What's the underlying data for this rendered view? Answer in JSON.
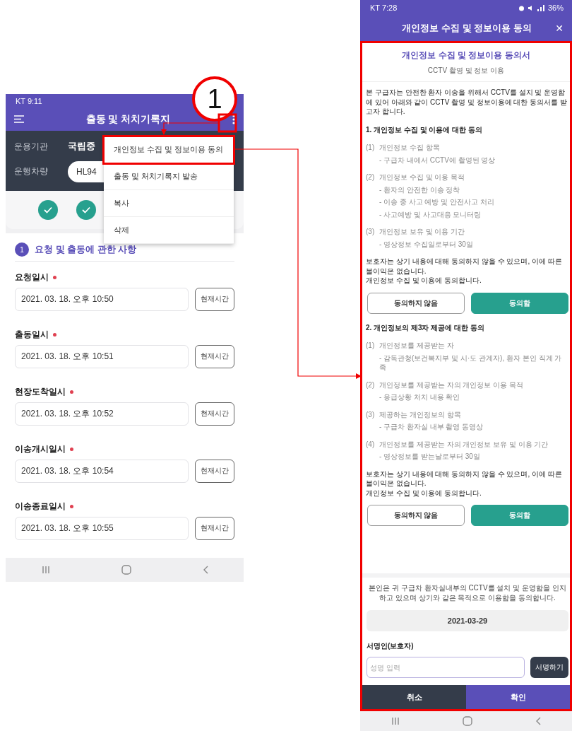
{
  "left_phone": {
    "status_bar": {
      "carrier_time": "KT 9:11"
    },
    "header": {
      "title": "출동 및 처치기록지"
    },
    "info": [
      {
        "kind": "text",
        "label": "운용기관",
        "value": "국립중"
      },
      {
        "kind": "pill",
        "label": "운행차량",
        "value": "HL94"
      }
    ],
    "steps": [
      {
        "done": true
      },
      {
        "done": true
      }
    ],
    "menu": [
      {
        "label": "개인정보 수집 및 정보이용 동의",
        "highlighted": true
      },
      {
        "label": "출동 및 처치기록지 발송",
        "highlighted": false
      },
      {
        "label": "복사",
        "highlighted": false
      },
      {
        "label": "삭제",
        "highlighted": false
      }
    ],
    "section": {
      "number": "1",
      "title": "요청 및 출동에 관한 사항"
    },
    "fields": [
      {
        "label": "요청일시",
        "required": true,
        "value": "2021. 03. 18. 오후 10:50",
        "button": "현재시간"
      },
      {
        "label": "출동일시",
        "required": true,
        "value": "2021. 03. 18. 오후 10:51",
        "button": "현재시간"
      },
      {
        "label": "현장도착일시",
        "required": true,
        "value": "2021. 03. 18. 오후 10:52",
        "button": "현재시간"
      },
      {
        "label": "이송개시일시",
        "required": true,
        "value": "2021. 03. 18. 오후 10:54",
        "button": "현재시간"
      },
      {
        "label": "이송종료일시",
        "required": true,
        "value": "2021. 03. 18. 오후 10:55",
        "button": "현재시간"
      }
    ]
  },
  "annotation": {
    "callout": "1"
  },
  "right_phone": {
    "status_bar": {
      "carrier_time": "KT 7:28",
      "battery": "36%"
    },
    "header": {
      "title": "개인정보 수집 및 정보이용 동의",
      "close": "✕"
    },
    "doc_title": "개인정보 수집 및 정보이용 동의서",
    "doc_subtitle": "CCTV 촬영 및 정보 이용",
    "intro": "본 구급차는 안전한 환자 이송을 위해서 CCTV를 설치 및 운영함에 있어 아래와 같이 CCTV 촬영 및 정보이용에 대한 동의서를 받고자 합니다.",
    "sections": [
      {
        "heading": "1. 개인정보 수집 및 이용에 대한 동의",
        "items": [
          {
            "num": "(1)",
            "title": "개인정보 수집 항목",
            "details": [
              "- 구급차 내에서 CCTV에 촬영된 영상"
            ]
          },
          {
            "num": "(2)",
            "title": "개인정보 수집 및 이용 목적",
            "details": [
              "- 환자의 안전한 이송 정착",
              "- 이송 중 사고 예방 및 안전사고 처리",
              "- 사고예방 및 사고대응 모니터링"
            ]
          },
          {
            "num": "(3)",
            "title": "개인정보 보유 및 이용 기간",
            "details": [
              "- 영상정보 수집일로부터 30일"
            ]
          }
        ],
        "notice": "보호자는 상기 내용에 대해 동의하지 않을 수 있으며, 이에 따른 불이익은 없습니다.",
        "consent": "개인정보 수집 및 이용에 동의합니다.",
        "choices": [
          {
            "label": "동의하지 않음",
            "selected": false
          },
          {
            "label": "동의함",
            "selected": true
          }
        ]
      },
      {
        "heading": "2. 개인정보의 제3자 제공에 대한 동의",
        "items": [
          {
            "num": "(1)",
            "title": "개인정보를 제공받는 자",
            "details": [
              "- 감독관청(보건복지부 및 시·도 관계자), 환자 본인 직계 가족"
            ]
          },
          {
            "num": "(2)",
            "title": "개인정보를 제공받는 자의 개인정보 이용 목적",
            "details": [
              "- 응급상황 처치 내용 확인"
            ]
          },
          {
            "num": "(3)",
            "title": "제공하는 개인정보의 항목",
            "details": [
              "- 구급차 환자실 내부 촬영 동영상"
            ]
          },
          {
            "num": "(4)",
            "title": "개인정보를 제공받는 자의 개인정보 보유 및 이용 기간",
            "details": [
              "- 영상정보를 받는날로부터 30일"
            ]
          }
        ],
        "notice": "보호자는 상기 내용에 대해 동의하지 않을 수 있으며, 이에 따른 불이익은 없습니다.",
        "consent": "개인정보 수집 및 이용에 동의합니다.",
        "choices": [
          {
            "label": "동의하지 않음",
            "selected": false
          },
          {
            "label": "동의함",
            "selected": true
          }
        ]
      }
    ],
    "statement": "본인은 귀 구급차 환자실내부의 CCTV를 설치 및 운영함을 인지하고 있으며 상기와 같은 목적으로 이용함을 동의합니다.",
    "date": "2021-03-29",
    "signer_label": "서명인(보호자)",
    "name_placeholder": "성명 입력",
    "sign_button": "서명하기",
    "footer": [
      {
        "kind": "cancel",
        "label": "취소"
      },
      {
        "kind": "confirm",
        "label": "확인"
      }
    ]
  }
}
